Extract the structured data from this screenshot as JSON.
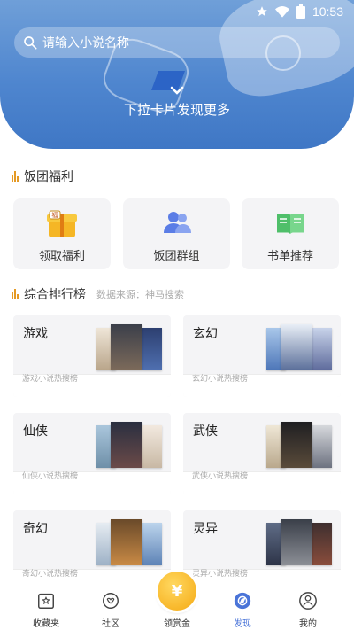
{
  "status_bar": {
    "time": "10:53"
  },
  "header": {
    "search_placeholder": "请输入小说名称",
    "pull_hint": "下拉卡片发现更多"
  },
  "benefits": {
    "title": "饭团福利",
    "items": [
      {
        "label": "领取福利",
        "icon": "gift-box-icon"
      },
      {
        "label": "饭团群组",
        "icon": "group-users-icon"
      },
      {
        "label": "书单推荐",
        "icon": "book-icon"
      }
    ]
  },
  "ranking": {
    "title": "综合排行榜",
    "source": "数据来源：神马搜索",
    "items": [
      {
        "name": "游戏",
        "desc": "游戏小说热搜榜"
      },
      {
        "name": "玄幻",
        "desc": "玄幻小说热搜榜"
      },
      {
        "name": "仙侠",
        "desc": "仙侠小说热搜榜"
      },
      {
        "name": "武侠",
        "desc": "武侠小说热搜榜"
      },
      {
        "name": "奇幻",
        "desc": "奇幻小说热搜榜"
      },
      {
        "name": "灵异",
        "desc": "灵异小说热搜榜"
      }
    ]
  },
  "tabbar": {
    "items": [
      {
        "label": "收藏夹",
        "icon": "bookshelf-icon"
      },
      {
        "label": "社区",
        "icon": "community-icon"
      },
      {
        "label": "领赏金",
        "icon": "coin-icon"
      },
      {
        "label": "发现",
        "icon": "discover-icon",
        "active": true
      },
      {
        "label": "我的",
        "icon": "profile-icon"
      }
    ],
    "coin_symbol": "¥",
    "active_color": "#4a74d8"
  },
  "colors": {
    "accent": "#e59a25",
    "banner": "#4f86cf"
  }
}
